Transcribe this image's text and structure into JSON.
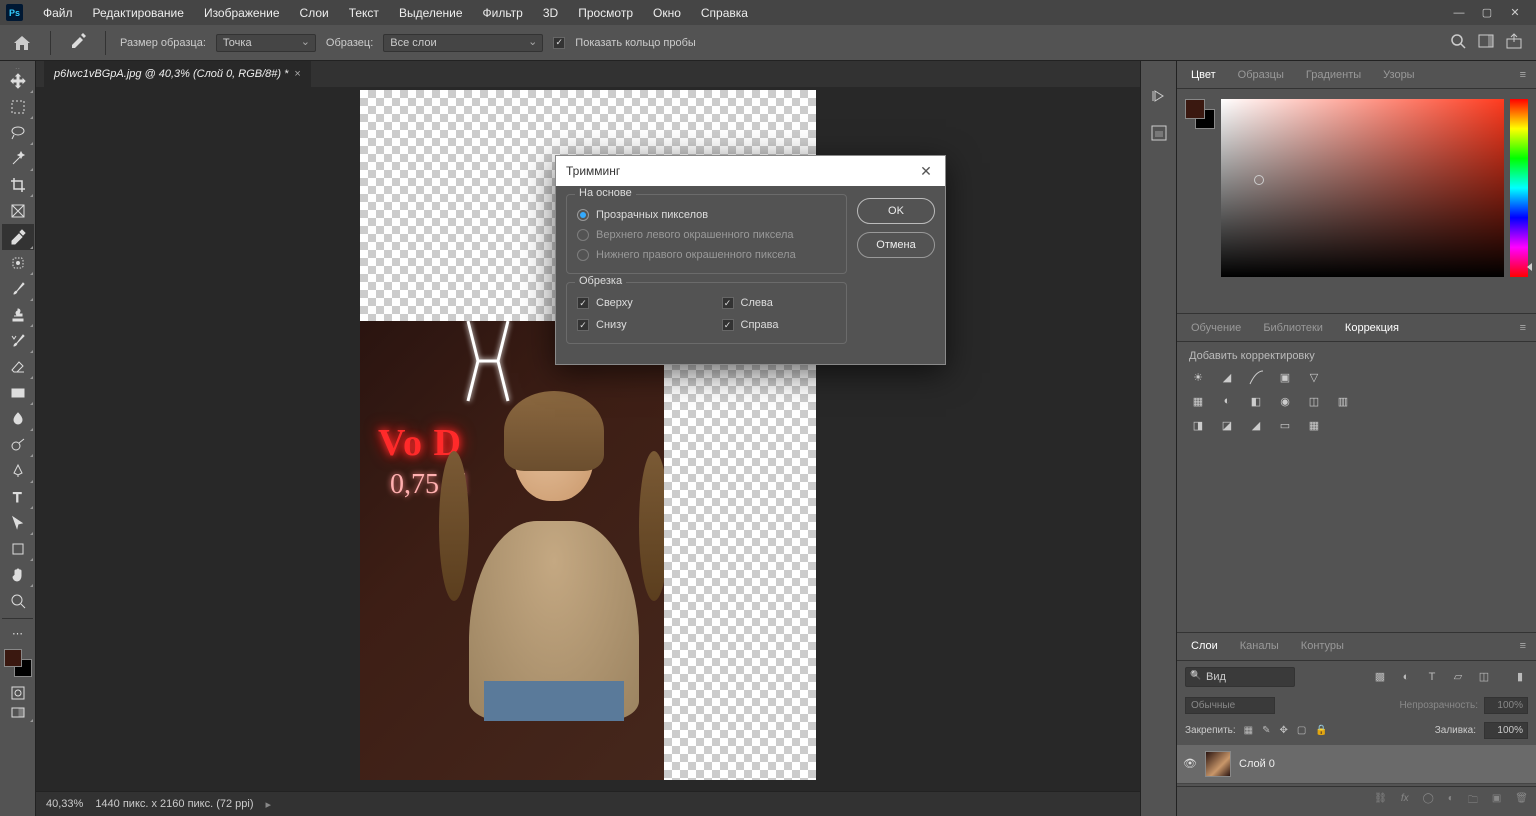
{
  "menu": {
    "items": [
      "Файл",
      "Редактирование",
      "Изображение",
      "Слои",
      "Текст",
      "Выделение",
      "Фильтр",
      "3D",
      "Просмотр",
      "Окно",
      "Справка"
    ]
  },
  "optbar": {
    "sample_label": "Размер образца:",
    "sample_val": "Точка",
    "sample2_label": "Образец:",
    "sample2_val": "Все слои",
    "show_ring": "Показать кольцо пробы"
  },
  "doc": {
    "tab": "p6Iwc1vBGpA.jpg @ 40,3% (Слой 0, RGB/8#) *"
  },
  "status": {
    "zoom": "40,33%",
    "dims": "1440 пикс. x 2160 пикс. (72 ppi)"
  },
  "colorTabs": [
    "Цвет",
    "Образцы",
    "Градиенты",
    "Узоры"
  ],
  "adjTabs": [
    "Обучение",
    "Библиотеки",
    "Коррекция"
  ],
  "adj": {
    "hint": "Добавить корректировку"
  },
  "layerTabs": [
    "Слои",
    "Каналы",
    "Контуры"
  ],
  "layers": {
    "search_ph": "Вид",
    "blend": "Обычные",
    "opacity_lbl": "Непрозрачность:",
    "opacity": "100%",
    "lock_lbl": "Закрепить:",
    "fill_lbl": "Заливка:",
    "fill": "100%",
    "items": [
      {
        "name": "Слой 0"
      }
    ]
  },
  "dialog": {
    "title": "Тримминг",
    "fs1": "На основе",
    "opts": [
      "Прозрачных пикселов",
      "Верхнего левого окрашенного пиксела",
      "Нижнего правого окрашенного пиксела"
    ],
    "fs2": "Обрезка",
    "sides": {
      "top": "Сверху",
      "bottom": "Снизу",
      "left": "Слева",
      "right": "Справа"
    },
    "ok": "OK",
    "cancel": "Отмена"
  },
  "neon": {
    "l1": "Vo D",
    "l2": "0,75 pl"
  }
}
